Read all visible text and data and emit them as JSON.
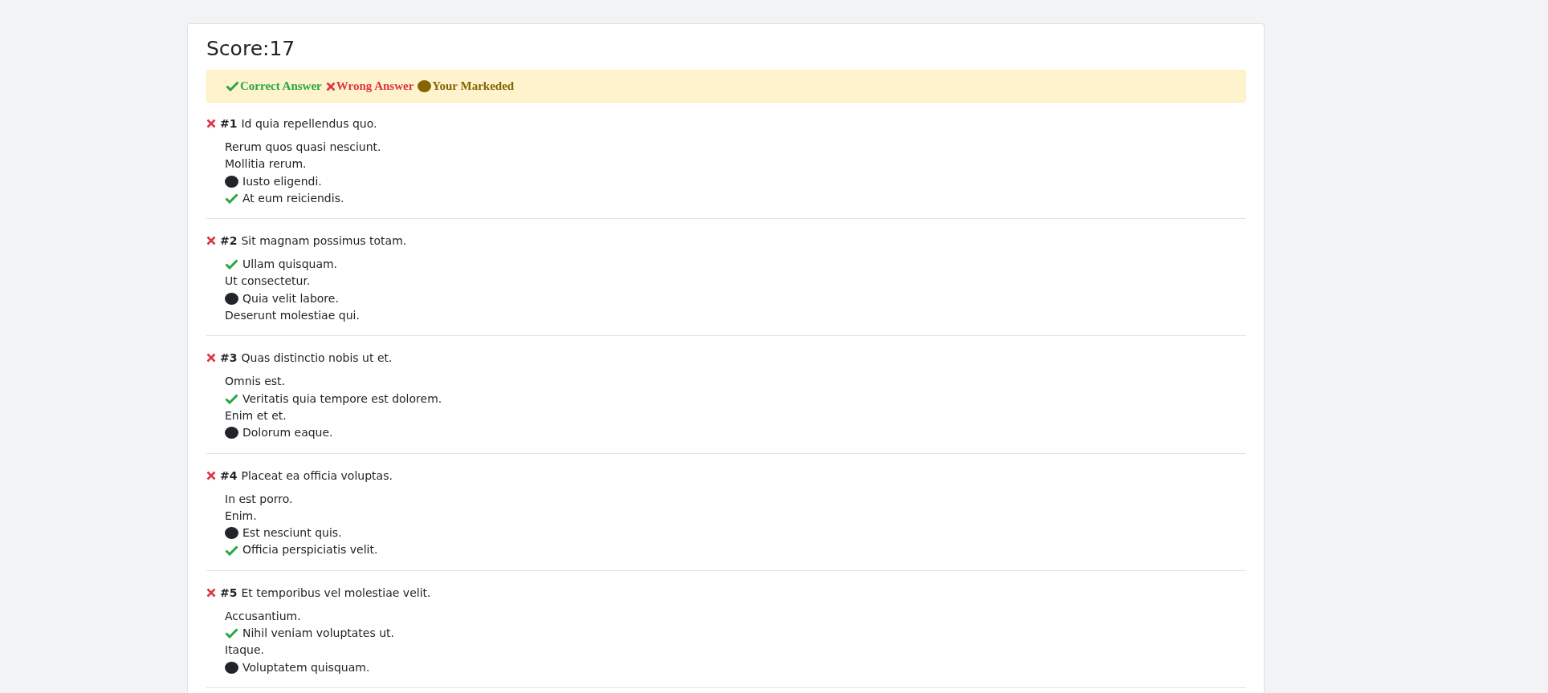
{
  "score": {
    "label": "Score:",
    "value": "17"
  },
  "legend": [
    {
      "kind": "correct",
      "label": "Correct Answer"
    },
    {
      "kind": "wrong",
      "label": "Wrong Answer"
    },
    {
      "kind": "marked",
      "label": "Your Markeded"
    }
  ],
  "questions": [
    {
      "number": "#1",
      "text": "Id quia repellendus quo.",
      "correct": false,
      "options": [
        {
          "text": "Rerum quos quasi nesciunt.",
          "correct": false,
          "marked": false
        },
        {
          "text": "Mollitia rerum.",
          "correct": false,
          "marked": false
        },
        {
          "text": "Iusto eligendi.",
          "correct": false,
          "marked": true
        },
        {
          "text": "At eum reiciendis.",
          "correct": true,
          "marked": false
        }
      ]
    },
    {
      "number": "#2",
      "text": "Sit magnam possimus totam.",
      "correct": false,
      "options": [
        {
          "text": "Ullam quisquam.",
          "correct": true,
          "marked": false
        },
        {
          "text": "Ut consectetur.",
          "correct": false,
          "marked": false
        },
        {
          "text": "Quia velit labore.",
          "correct": false,
          "marked": true
        },
        {
          "text": "Deserunt molestiae qui.",
          "correct": false,
          "marked": false
        }
      ]
    },
    {
      "number": "#3",
      "text": "Quas distinctio nobis ut et.",
      "correct": false,
      "options": [
        {
          "text": "Omnis est.",
          "correct": false,
          "marked": false
        },
        {
          "text": "Veritatis quia tempore est dolorem.",
          "correct": true,
          "marked": false
        },
        {
          "text": "Enim et et.",
          "correct": false,
          "marked": false
        },
        {
          "text": "Dolorum eaque.",
          "correct": false,
          "marked": true
        }
      ]
    },
    {
      "number": "#4",
      "text": "Placeat ea officia voluptas.",
      "correct": false,
      "options": [
        {
          "text": "In est porro.",
          "correct": false,
          "marked": false
        },
        {
          "text": "Enim.",
          "correct": false,
          "marked": false
        },
        {
          "text": "Est nesciunt quis.",
          "correct": false,
          "marked": true
        },
        {
          "text": "Officia perspiciatis velit.",
          "correct": true,
          "marked": false
        }
      ]
    },
    {
      "number": "#5",
      "text": "Et temporibus vel molestiae velit.",
      "correct": false,
      "options": [
        {
          "text": "Accusantium.",
          "correct": false,
          "marked": false
        },
        {
          "text": "Nihil veniam voluptates ut.",
          "correct": true,
          "marked": false
        },
        {
          "text": "Itaque.",
          "correct": false,
          "marked": false
        },
        {
          "text": "Voluptatem quisquam.",
          "correct": false,
          "marked": true
        }
      ]
    }
  ]
}
